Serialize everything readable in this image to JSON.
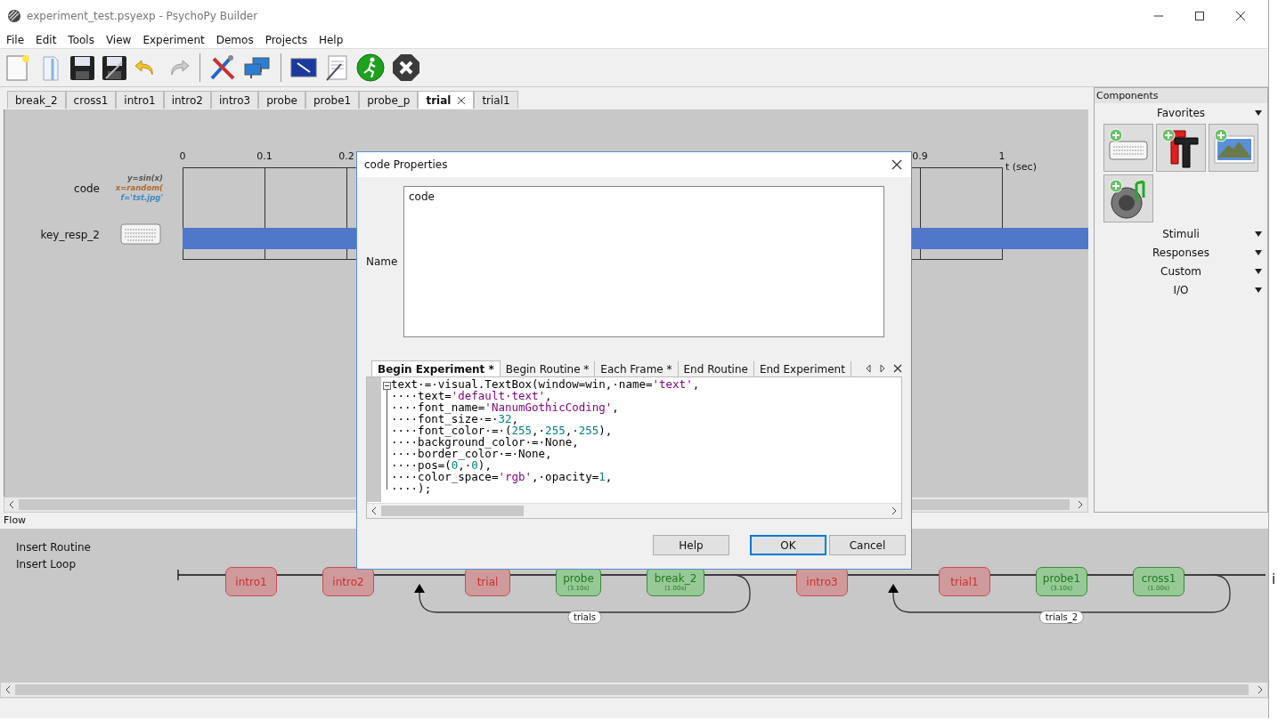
{
  "window": {
    "title": "experiment_test.psyexp - PsychoPy Builder"
  },
  "menu": [
    "File",
    "Edit",
    "Tools",
    "View",
    "Experiment",
    "Demos",
    "Projects",
    "Help"
  ],
  "routine_tabs": [
    {
      "label": "break_2",
      "selected": false
    },
    {
      "label": "cross1",
      "selected": false
    },
    {
      "label": "intro1",
      "selected": false
    },
    {
      "label": "intro2",
      "selected": false
    },
    {
      "label": "intro3",
      "selected": false
    },
    {
      "label": "probe",
      "selected": false
    },
    {
      "label": "probe1",
      "selected": false
    },
    {
      "label": "probe_p",
      "selected": false
    },
    {
      "label": "trial",
      "selected": true
    },
    {
      "label": "trial1",
      "selected": false
    }
  ],
  "timeline": {
    "ticks": [
      "0",
      "0.1",
      "0.2",
      "0.9",
      "1"
    ],
    "unit": "t (sec)",
    "rows": [
      {
        "kind": "code",
        "name": "code",
        "snippets": [
          "y=sin(x)",
          "x=random(",
          "f='tst.jpg'"
        ]
      },
      {
        "kind": "keyboard",
        "name": "key_resp_2"
      }
    ]
  },
  "components": {
    "title": "Components",
    "favorites": "Favorites",
    "sections": [
      "Stimuli",
      "Responses",
      "Custom",
      "I/O"
    ]
  },
  "dialog": {
    "title": "code Properties",
    "name_label": "Name",
    "name_value": "code",
    "tabs": [
      {
        "label": "Begin Experiment *",
        "selected": true
      },
      {
        "label": "Begin Routine *",
        "selected": false
      },
      {
        "label": "Each Frame *",
        "selected": false
      },
      {
        "label": "End Routine",
        "selected": false
      },
      {
        "label": "End Experiment",
        "selected": false
      }
    ],
    "code": [
      [
        {
          "kind": "plain",
          "text": "text·=·visual.TextBox(window=win,·name="
        },
        {
          "kind": "string",
          "text": "'text'"
        },
        {
          "kind": "plain",
          "text": ","
        }
      ],
      [
        {
          "kind": "plain",
          "text": "····text="
        },
        {
          "kind": "string",
          "text": "'default·text'"
        },
        {
          "kind": "plain",
          "text": ","
        }
      ],
      [
        {
          "kind": "plain",
          "text": "····font_name="
        },
        {
          "kind": "string",
          "text": "'NanumGothicCoding'"
        },
        {
          "kind": "plain",
          "text": ","
        }
      ],
      [
        {
          "kind": "plain",
          "text": "····font_size·=·"
        },
        {
          "kind": "number",
          "text": "32"
        },
        {
          "kind": "plain",
          "text": ","
        }
      ],
      [
        {
          "kind": "plain",
          "text": "····font_color·=·("
        },
        {
          "kind": "number",
          "text": "255"
        },
        {
          "kind": "plain",
          "text": ",·"
        },
        {
          "kind": "number",
          "text": "255"
        },
        {
          "kind": "plain",
          "text": ",·"
        },
        {
          "kind": "number",
          "text": "255"
        },
        {
          "kind": "plain",
          "text": "),"
        }
      ],
      [
        {
          "kind": "plain",
          "text": "····background_color·=·None,"
        }
      ],
      [
        {
          "kind": "plain",
          "text": "····border_color·=·None,"
        }
      ],
      [
        {
          "kind": "plain",
          "text": "····pos=("
        },
        {
          "kind": "number",
          "text": "0"
        },
        {
          "kind": "plain",
          "text": ",·"
        },
        {
          "kind": "number",
          "text": "0"
        },
        {
          "kind": "plain",
          "text": "),"
        }
      ],
      [
        {
          "kind": "plain",
          "text": "····color_space="
        },
        {
          "kind": "string",
          "text": "'rgb'"
        },
        {
          "kind": "plain",
          "text": ",·opacity="
        },
        {
          "kind": "number",
          "text": "1"
        },
        {
          "kind": "plain",
          "text": ","
        }
      ],
      [
        {
          "kind": "plain",
          "text": "····);"
        }
      ]
    ],
    "buttons": [
      {
        "label": "Help",
        "focused": false
      },
      {
        "label": "OK",
        "focused": true
      },
      {
        "label": "Cancel",
        "focused": false
      }
    ]
  },
  "flow": {
    "title": "Flow",
    "actions": [
      "Insert Routine",
      "Insert Loop"
    ],
    "items": [
      {
        "kind": "routine",
        "name": "intro1",
        "timed": false
      },
      {
        "kind": "routine",
        "name": "intro2",
        "timed": false
      },
      {
        "kind": "loop",
        "name": "trials",
        "routines": [
          {
            "name": "trial",
            "timed": false
          },
          {
            "name": "probe",
            "timed": true,
            "duration": "(3.10s)"
          },
          {
            "name": "break_2",
            "timed": true,
            "duration": "(1.00s)"
          }
        ]
      },
      {
        "kind": "routine",
        "name": "intro3",
        "timed": false
      },
      {
        "kind": "loop",
        "name": "trials_2",
        "routines": [
          {
            "name": "trial1",
            "timed": false
          },
          {
            "name": "probe1",
            "timed": true,
            "duration": "(3.10s)"
          },
          {
            "name": "cross1",
            "timed": true,
            "duration": "(1.00s)"
          }
        ]
      }
    ]
  },
  "edge_text": "i"
}
